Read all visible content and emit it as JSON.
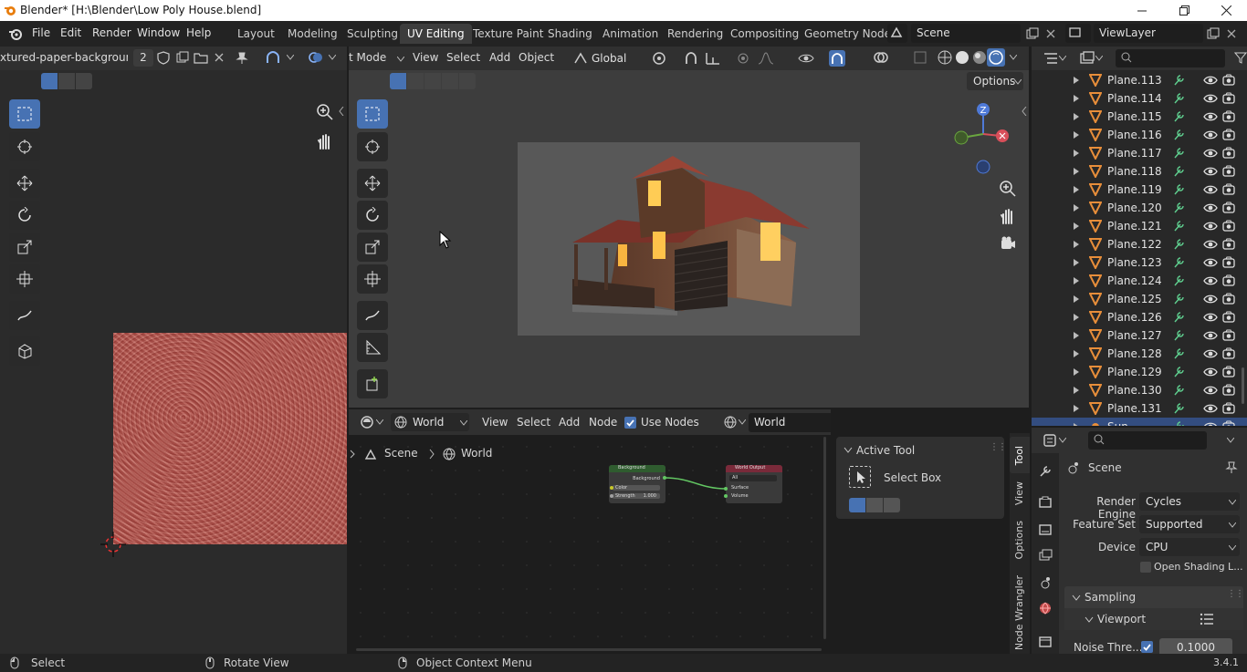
{
  "window": {
    "title": "Blender* [H:\\Blender\\Low Poly House.blend]"
  },
  "menu": {
    "file": "File",
    "edit": "Edit",
    "render": "Render",
    "window": "Window",
    "help": "Help"
  },
  "workspaces": [
    "Layout",
    "Modeling",
    "Sculpting",
    "UV Editing",
    "Texture Paint",
    "Shading",
    "Animation",
    "Rendering",
    "Compositing",
    "Geometry Node"
  ],
  "active_workspace": "UV Editing",
  "scene_field": "Scene",
  "viewlayer_field": "ViewLayer",
  "image_editor": {
    "image_name": "xtured-paper-background.jpg",
    "users": "2"
  },
  "viewport": {
    "mode": "t Mode",
    "menus": {
      "view": "View",
      "select": "Select",
      "add": "Add",
      "object": "Object"
    },
    "orientation": "Global",
    "options": "Options",
    "gizmo": {
      "z": "Z"
    }
  },
  "outliner": {
    "rows": [
      "Plane.113",
      "Plane.114",
      "Plane.115",
      "Plane.116",
      "Plane.117",
      "Plane.118",
      "Plane.119",
      "Plane.120",
      "Plane.121",
      "Plane.122",
      "Plane.123",
      "Plane.124",
      "Plane.125",
      "Plane.126",
      "Plane.127",
      "Plane.128",
      "Plane.129",
      "Plane.130",
      "Plane.131",
      "Sun"
    ]
  },
  "node_editor": {
    "world_selector": "World",
    "menus": {
      "view": "View",
      "select": "Select",
      "add": "Add",
      "node": "Node"
    },
    "use_nodes": "Use Nodes",
    "world_field": "World",
    "breadcrumb": {
      "scene": "Scene",
      "world": "World"
    },
    "node_background": {
      "title": "Background",
      "output": "Background",
      "color": "Color",
      "strength": "Strength",
      "strength_value": "1.000"
    },
    "node_output": {
      "title": "World Output",
      "target": "All",
      "surface": "Surface",
      "volume": "Volume"
    },
    "sidebar": {
      "panel": "Active Tool",
      "tool": "Select Box"
    },
    "tabs": [
      "Tool",
      "View",
      "Options",
      "Node Wrangler"
    ]
  },
  "properties": {
    "context": "Scene",
    "render_engine_label": "Render Engine",
    "render_engine": "Cycles",
    "feature_set_label": "Feature Set",
    "feature_set": "Supported",
    "device_label": "Device",
    "device": "CPU",
    "open_shading": "Open Shading L...",
    "sampling": "Sampling",
    "viewport": "Viewport",
    "noise_label": "Noise Thre...",
    "noise_value": "0.1000"
  },
  "status": {
    "select": "Select",
    "rotate": "Rotate View",
    "context_menu": "Object Context Menu",
    "version": "3.4.1"
  },
  "colors": {
    "accent": "#4772b3",
    "mesh_icon": "#e88e3a",
    "header": "#303030",
    "bg": "#1d1d1d"
  }
}
